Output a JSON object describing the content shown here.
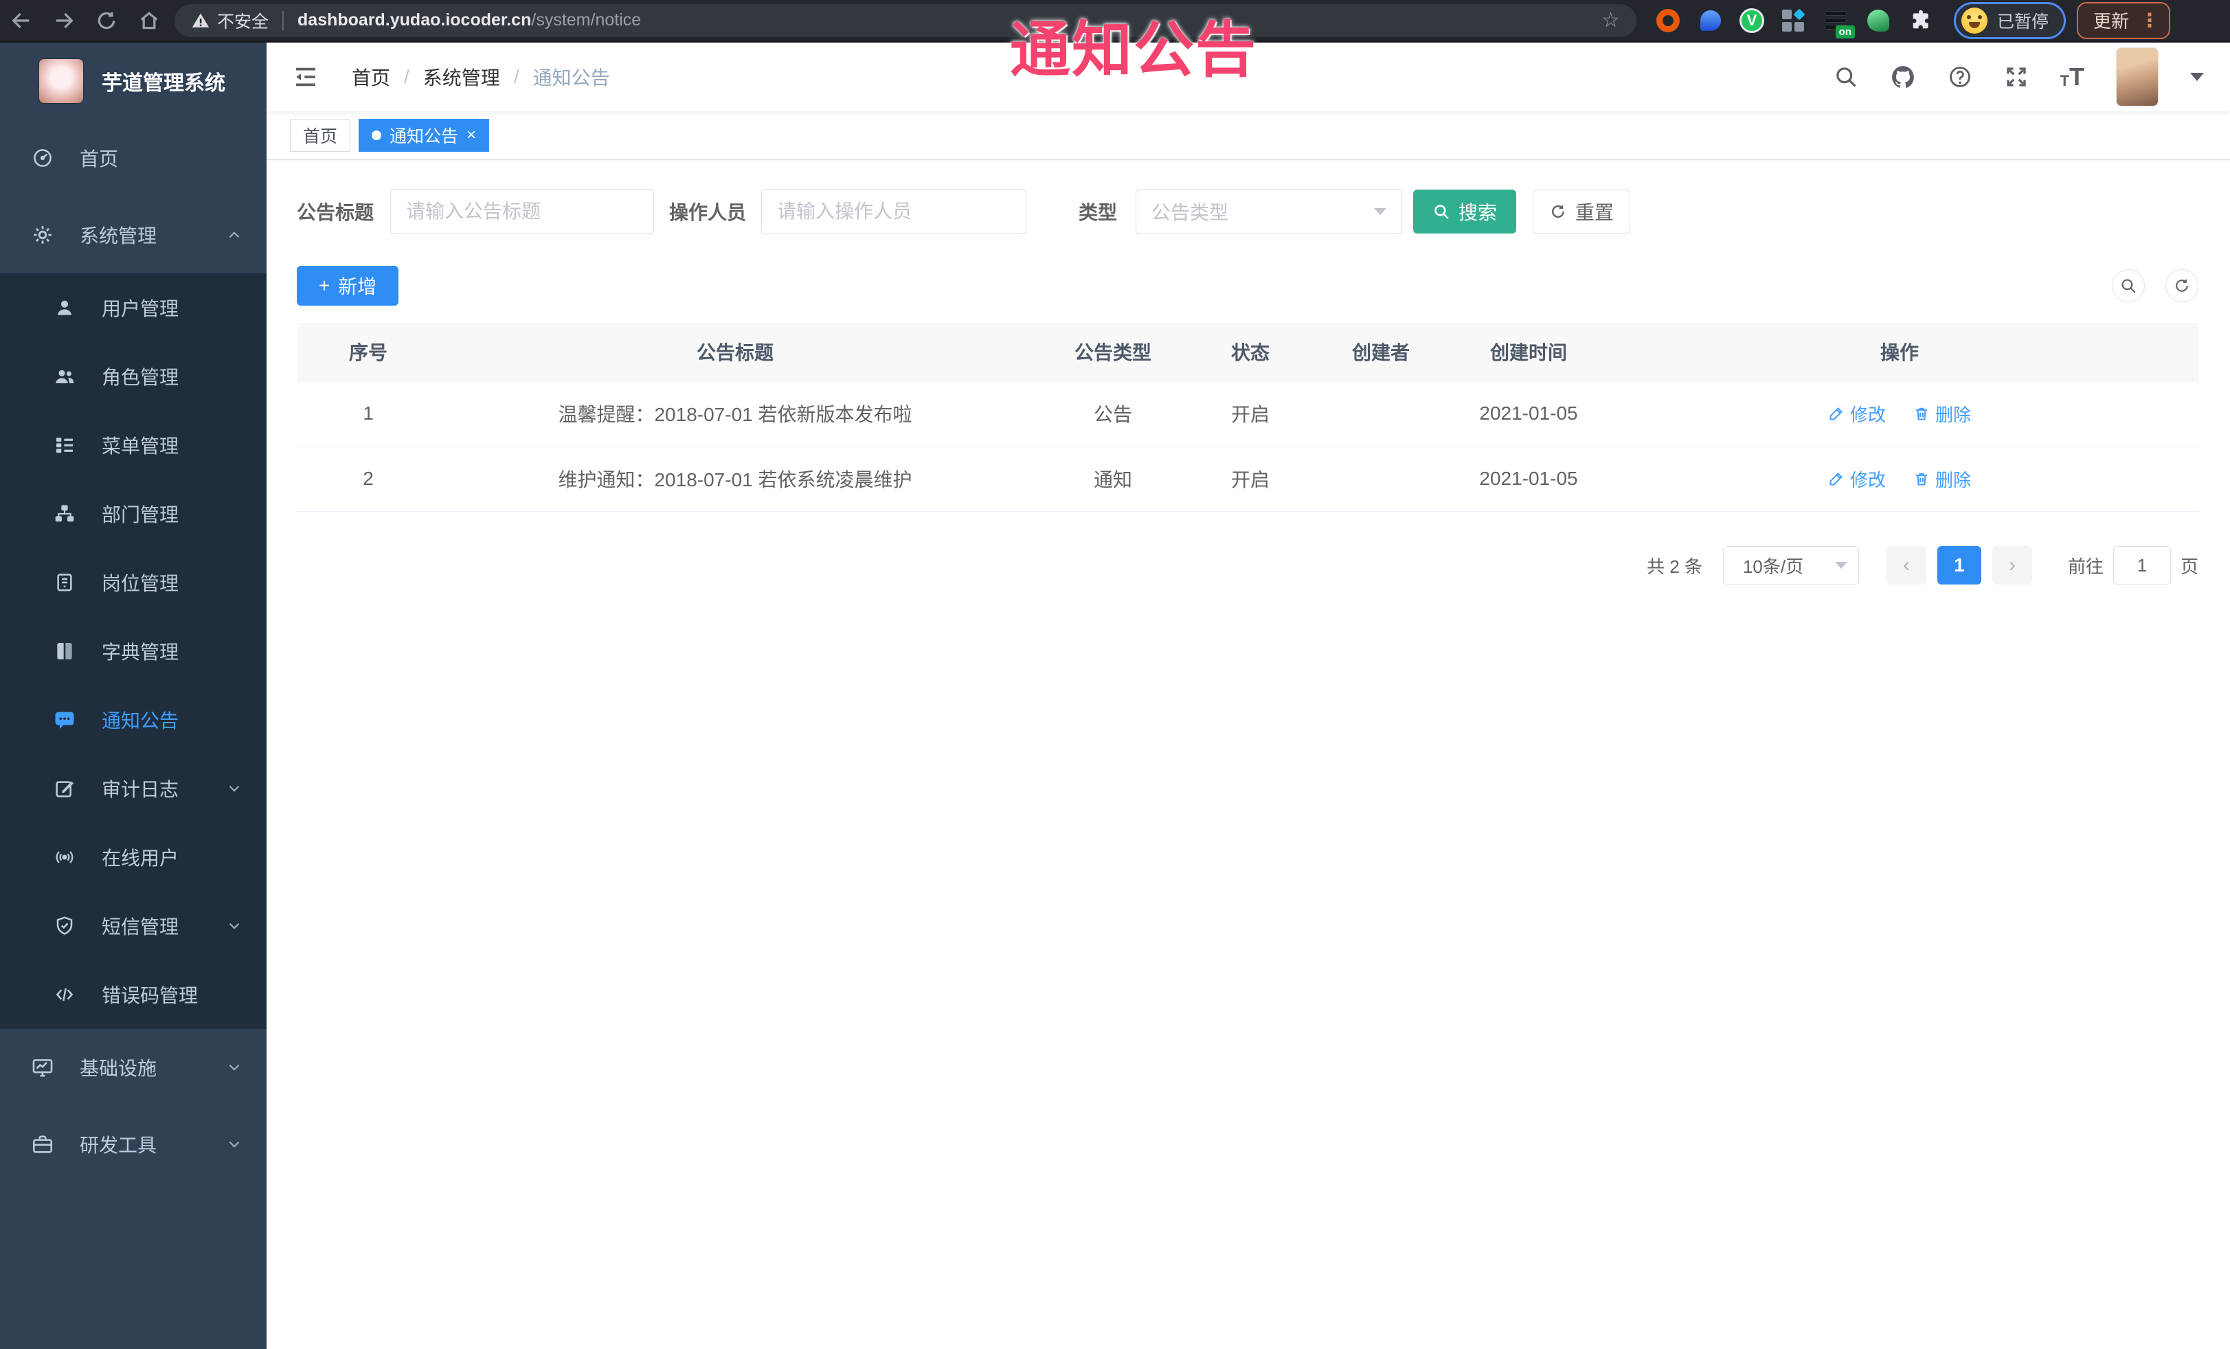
{
  "browser": {
    "security_warning": "不安全",
    "url_host": "dashboard.yudao.iocoder.cn",
    "url_path": "/system/notice",
    "star": "☆",
    "ext_v_letter": "V",
    "ext_on_badge": "on",
    "paused_badge": "已暂停",
    "update_label": "更新",
    "menu_dots": "⋮"
  },
  "watermark": "通知公告",
  "sidebar": {
    "app_title": "芋道管理系统",
    "items": [
      {
        "label": "首页"
      },
      {
        "label": "系统管理"
      },
      {
        "label": "用户管理"
      },
      {
        "label": "角色管理"
      },
      {
        "label": "菜单管理"
      },
      {
        "label": "部门管理"
      },
      {
        "label": "岗位管理"
      },
      {
        "label": "字典管理"
      },
      {
        "label": "通知公告"
      },
      {
        "label": "审计日志"
      },
      {
        "label": "在线用户"
      },
      {
        "label": "短信管理"
      },
      {
        "label": "错误码管理"
      },
      {
        "label": "基础设施"
      },
      {
        "label": "研发工具"
      }
    ]
  },
  "header": {
    "breadcrumb": [
      "首页",
      "系统管理",
      "通知公告"
    ],
    "separator": "/"
  },
  "tags": [
    {
      "label": "首页"
    },
    {
      "label": "通知公告",
      "close": "×"
    }
  ],
  "filters": {
    "title_label": "公告标题",
    "title_placeholder": "请输入公告标题",
    "operator_label": "操作人员",
    "operator_placeholder": "请输入操作人员",
    "type_label": "类型",
    "type_placeholder": "公告类型",
    "search_label": "搜索",
    "reset_label": "重置"
  },
  "toolbar": {
    "plus": "+",
    "add_label": "新增"
  },
  "table": {
    "headers": [
      "序号",
      "公告标题",
      "公告类型",
      "状态",
      "创建者",
      "创建时间",
      "操作"
    ],
    "rows": [
      {
        "index": "1",
        "title": "温馨提醒：2018-07-01 若依新版本发布啦",
        "type": "公告",
        "status": "开启",
        "creator": "",
        "created": "2021-01-05",
        "edit": "修改",
        "remove": "删除"
      },
      {
        "index": "2",
        "title": "维护通知：2018-07-01 若依系统凌晨维护",
        "type": "通知",
        "status": "开启",
        "creator": "",
        "created": "2021-01-05",
        "edit": "修改",
        "remove": "删除"
      }
    ]
  },
  "pagination": {
    "total": "共 2 条",
    "page_size": "10条/页",
    "prev": "‹",
    "current": "1",
    "next": "›",
    "goto_label": "前往",
    "goto_value": "1",
    "unit": "页"
  },
  "colors": {
    "accent_blue": "#2f8df4",
    "element_blue": "#409eff",
    "search_teal": "#30b08f",
    "sidebar_bg": "#304156",
    "submenu_bg": "#1f2d3d",
    "watermark_pink": "#f4436e",
    "chrome_bg": "#23262d"
  }
}
